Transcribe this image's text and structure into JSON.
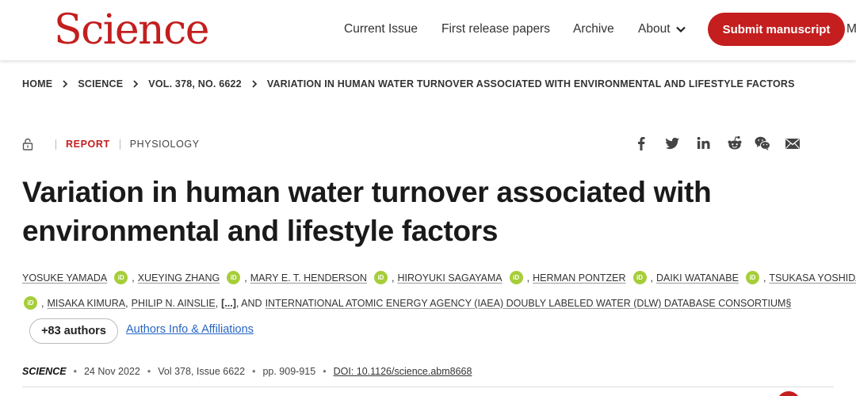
{
  "header": {
    "logo": "Science",
    "nav": [
      "Current Issue",
      "First release papers",
      "Archive",
      "About"
    ],
    "submit": "Submit manuscript",
    "nav_cut": "Ma"
  },
  "breadcrumb": [
    "HOME",
    "SCIENCE",
    "VOL. 378, NO. 6622",
    "VARIATION IN HUMAN WATER TURNOVER ASSOCIATED WITH ENVIRONMENTAL AND LIFESTYLE FACTORS"
  ],
  "article": {
    "type": "REPORT",
    "subject": "PHYSIOLOGY",
    "title": "Variation in human water turnover associated with environmental and lifestyle factors",
    "authors_line1": [
      "YOSUKE YAMADA",
      "XUEYING ZHANG",
      "MARY E. T. HENDERSON",
      "HIROYUKI SAGAYAMA",
      "HERMAN PONTZER",
      "DAIKI WATANABE",
      "TSUKASA YOSHIDA"
    ],
    "authors_line2": {
      "a1": "MISAKA KIMURA",
      "a2": "PHILIP N. AINSLIE",
      "ellipsis": "[...]",
      "and": ", AND",
      "consortium": "INTERNATIONAL ATOMIC ENERGY AGENCY (IAEA) DOUBLY LABELED WATER (DLW) DATABASE CONSORTIUM§"
    },
    "comma": ",",
    "orcid": "iD",
    "more_authors": "+83 authors",
    "affiliations": "Authors Info & Affiliations",
    "journal": "SCIENCE",
    "date": "24 Nov 2022",
    "volume": "Vol 378, Issue 6622",
    "pages": "pp. 909-915",
    "doi": "DOI: 10.1126/science.abm8668"
  },
  "share_icons": [
    "facebook-icon",
    "twitter-icon",
    "linkedin-icon",
    "reddit-icon",
    "wechat-icon",
    "email-icon"
  ],
  "colors": {
    "brand": "#c41e1e",
    "orcid": "#a6ce39",
    "link": "#2866c3"
  }
}
